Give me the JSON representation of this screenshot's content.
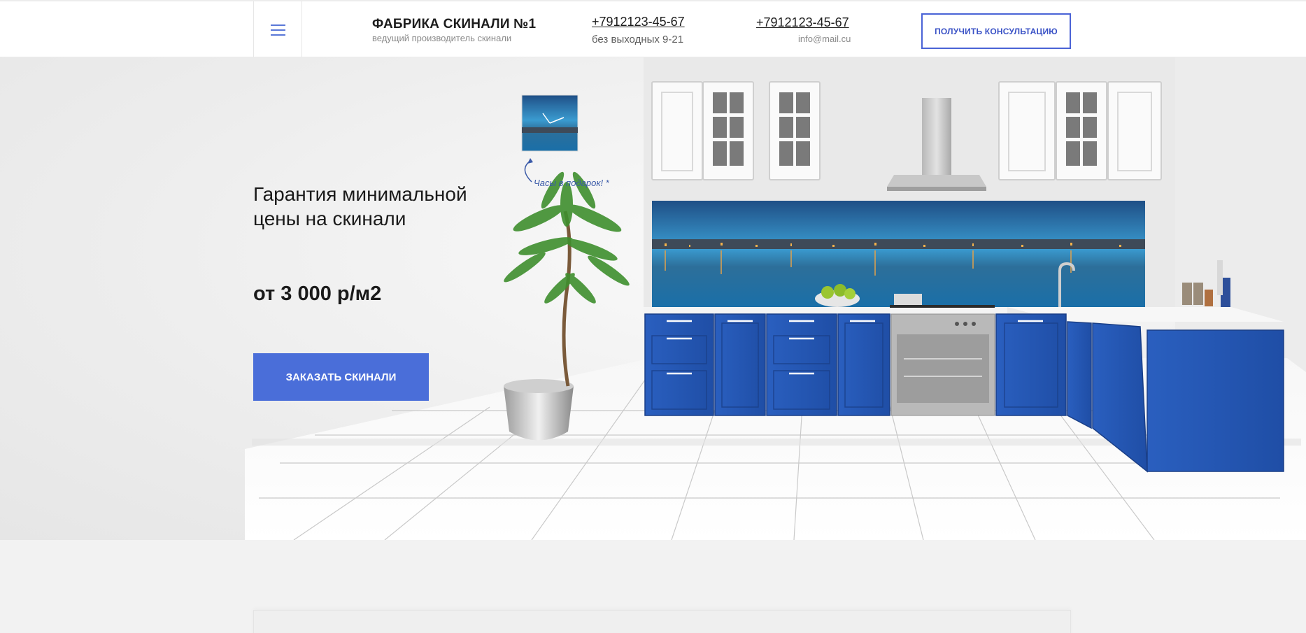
{
  "header": {
    "brand_title": "ФАБРИКА СКИНАЛИ №1",
    "brand_subtitle": "ведущий производитель скинали",
    "phone_primary": "+7912123-45-67",
    "hours": "без выходных 9-21",
    "phone_secondary": "+7912123-45-67",
    "email": "info@mail.cu",
    "consult_button": "ПОЛУЧИТЬ КОНСУЛЬТАЦИЮ"
  },
  "hero": {
    "headline": "Гарантия минимальной цены на скинали",
    "price": "от 3 000 р/м2",
    "order_button": "ЗАКАЗАТЬ СКИНАЛИ",
    "gift_note": "Часы в подарок! *"
  },
  "colors": {
    "accent": "#4a6ed9",
    "cabinet_blue": "#2355b4",
    "page_bg": "#f2f2f2"
  },
  "icons": {
    "menu": "hamburger-menu-icon"
  }
}
